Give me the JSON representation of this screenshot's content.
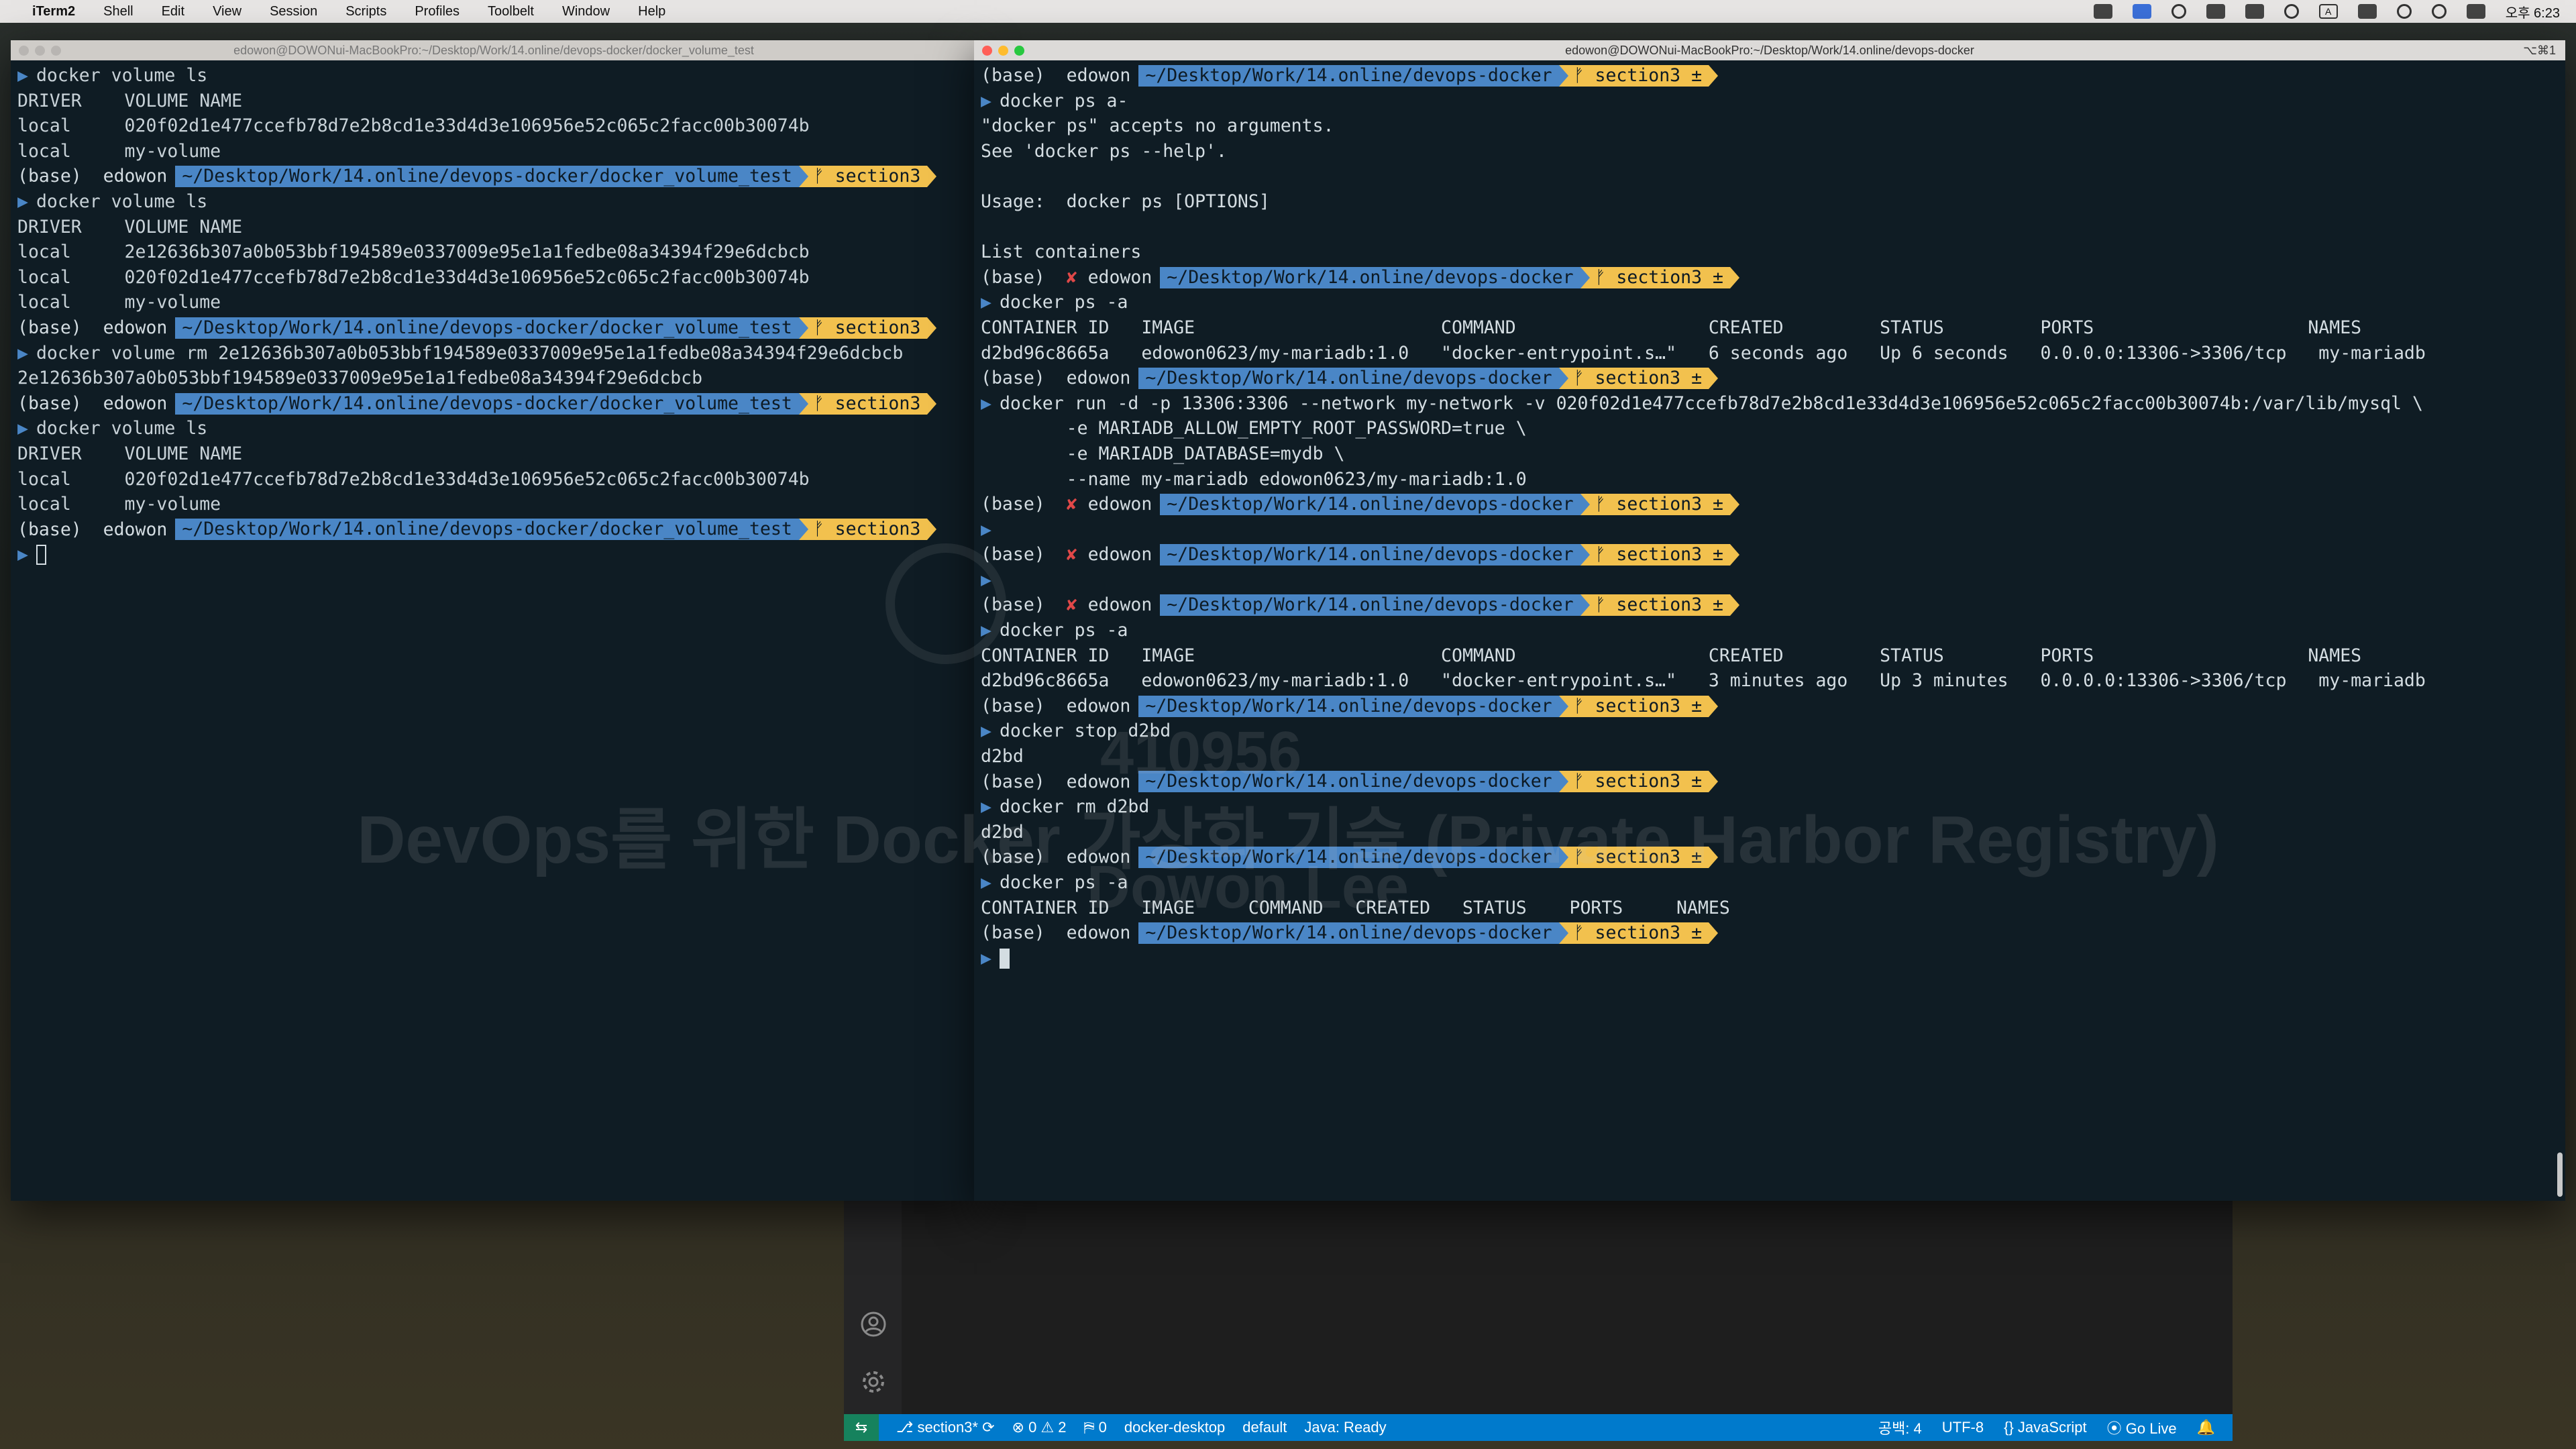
{
  "menubar": {
    "app": "iTerm2",
    "items": [
      "Shell",
      "Edit",
      "View",
      "Session",
      "Scripts",
      "Profiles",
      "Toolbelt",
      "Window",
      "Help"
    ],
    "clock": "오후 6:23"
  },
  "left_terminal": {
    "title": "edowon@DOWONui-MacBookPro:~/Desktop/Work/14.online/devops-docker/docker_volume_test",
    "prompt": {
      "env": "(base)",
      "user": "edowon",
      "dir": "~/Desktop/Work/14.online/devops-docker/docker_volume_test",
      "git": "ᚠ section3"
    },
    "lines": [
      {
        "type": "cmd",
        "text": "docker volume ls"
      },
      {
        "type": "out",
        "text": "DRIVER    VOLUME NAME"
      },
      {
        "type": "out",
        "text": "local     020f02d1e477ccefb78d7e2b8cd1e33d4d3e106956e52c065c2facc00b30074b"
      },
      {
        "type": "out",
        "text": "local     my-volume"
      },
      {
        "type": "prompt"
      },
      {
        "type": "cmd",
        "text": "docker volume ls"
      },
      {
        "type": "out",
        "text": "DRIVER    VOLUME NAME"
      },
      {
        "type": "out",
        "text": "local     2e12636b307a0b053bbf194589e0337009e95e1a1fedbe08a34394f29e6dcbcb"
      },
      {
        "type": "out",
        "text": "local     020f02d1e477ccefb78d7e2b8cd1e33d4d3e106956e52c065c2facc00b30074b"
      },
      {
        "type": "out",
        "text": "local     my-volume"
      },
      {
        "type": "prompt"
      },
      {
        "type": "cmd",
        "text": "docker volume rm 2e12636b307a0b053bbf194589e0337009e95e1a1fedbe08a34394f29e6dcbcb"
      },
      {
        "type": "out",
        "text": "2e12636b307a0b053bbf194589e0337009e95e1a1fedbe08a34394f29e6dcbcb"
      },
      {
        "type": "prompt"
      },
      {
        "type": "cmd",
        "text": "docker volume ls"
      },
      {
        "type": "out",
        "text": "DRIVER    VOLUME NAME"
      },
      {
        "type": "out",
        "text": "local     020f02d1e477ccefb78d7e2b8cd1e33d4d3e106956e52c065c2facc00b30074b"
      },
      {
        "type": "out",
        "text": "local     my-volume"
      },
      {
        "type": "prompt"
      },
      {
        "type": "cursor"
      }
    ]
  },
  "right_terminal": {
    "title": "edowon@DOWONui-MacBookPro:~/Desktop/Work/14.online/devops-docker",
    "shortcut": "⌥⌘1",
    "prompt": {
      "env": "(base)",
      "user": "edowon",
      "dir": "~/Desktop/Work/14.online/devops-docker",
      "git": "ᚠ section3 ±",
      "err": "✘"
    },
    "lines": [
      {
        "type": "prompt"
      },
      {
        "type": "cmd",
        "text": "docker ps a-"
      },
      {
        "type": "out",
        "text": "\"docker ps\" accepts no arguments."
      },
      {
        "type": "out",
        "text": "See 'docker ps --help'."
      },
      {
        "type": "out",
        "text": ""
      },
      {
        "type": "out",
        "text": "Usage:  docker ps [OPTIONS]"
      },
      {
        "type": "out",
        "text": ""
      },
      {
        "type": "out",
        "text": "List containers"
      },
      {
        "type": "prompt_err"
      },
      {
        "type": "cmd",
        "text": "docker ps -a"
      },
      {
        "type": "out",
        "text": "CONTAINER ID   IMAGE                       COMMAND                  CREATED         STATUS         PORTS                    NAMES"
      },
      {
        "type": "out",
        "text": "d2bd96c8665a   edowon0623/my-mariadb:1.0   \"docker-entrypoint.s…\"   6 seconds ago   Up 6 seconds   0.0.0.0:13306->3306/tcp   my-mariadb"
      },
      {
        "type": "prompt"
      },
      {
        "type": "cmd",
        "text": "docker run -d -p 13306:3306 --network my-network -v 020f02d1e477ccefb78d7e2b8cd1e33d4d3e106956e52c065c2facc00b30074b:/var/lib/mysql \\"
      },
      {
        "type": "out",
        "text": "        -e MARIADB_ALLOW_EMPTY_ROOT_PASSWORD=true \\"
      },
      {
        "type": "out",
        "text": "        -e MARIADB_DATABASE=mydb \\"
      },
      {
        "type": "out",
        "text": "        --name my-mariadb edowon0623/my-mariadb:1.0"
      },
      {
        "type": "prompt_err"
      },
      {
        "type": "cmd",
        "text": ""
      },
      {
        "type": "prompt_err"
      },
      {
        "type": "cmd",
        "text": ""
      },
      {
        "type": "prompt_err"
      },
      {
        "type": "cmd",
        "text": "docker ps -a"
      },
      {
        "type": "out",
        "text": "CONTAINER ID   IMAGE                       COMMAND                  CREATED         STATUS         PORTS                    NAMES"
      },
      {
        "type": "out",
        "text": "d2bd96c8665a   edowon0623/my-mariadb:1.0   \"docker-entrypoint.s…\"   3 minutes ago   Up 3 minutes   0.0.0.0:13306->3306/tcp   my-mariadb"
      },
      {
        "type": "prompt"
      },
      {
        "type": "cmd",
        "text": "docker stop d2bd"
      },
      {
        "type": "out",
        "text": "d2bd"
      },
      {
        "type": "prompt"
      },
      {
        "type": "cmd",
        "text": "docker rm d2bd"
      },
      {
        "type": "out",
        "text": "d2bd"
      },
      {
        "type": "prompt"
      },
      {
        "type": "cmd",
        "text": "docker ps -a"
      },
      {
        "type": "out",
        "text": "CONTAINER ID   IMAGE     COMMAND   CREATED   STATUS    PORTS     NAMES"
      },
      {
        "type": "prompt"
      },
      {
        "type": "cursor"
      }
    ]
  },
  "vscode_status": {
    "branch": "section3*",
    "errors": "0",
    "warnings": "2",
    "ports": "0",
    "context": "docker-desktop",
    "profile": "default",
    "java": "Java: Ready",
    "spaces": "공백: 4",
    "encoding": "UTF-8",
    "language": "JavaScript",
    "golive": "Go Live"
  },
  "watermark": {
    "number": "410956",
    "course": "DevOps를 위한 Docker 가상화 기술 (Private Harbor Registry)",
    "author": "Dowon Lee"
  }
}
